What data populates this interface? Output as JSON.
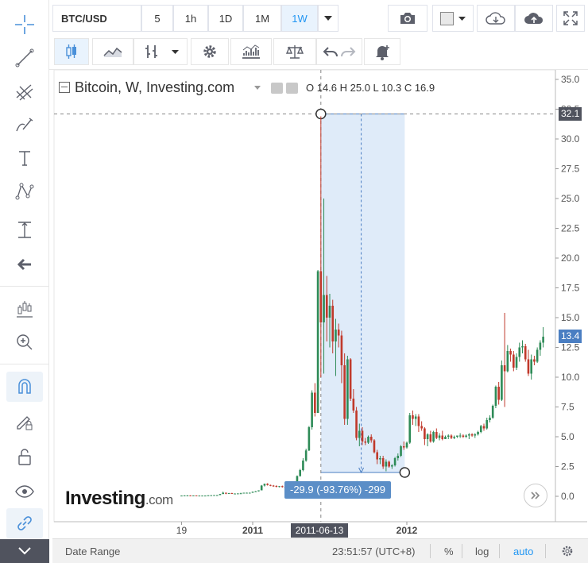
{
  "toolbar": {
    "symbol": "BTC/USD",
    "intervals": [
      "5",
      "1h",
      "1D",
      "1M",
      "1W"
    ],
    "active_interval": "1W"
  },
  "legend": {
    "title": "Bitcoin, W, Investing.com",
    "ohlc": "O 14.6  H 25.0  L 10.3  C 16.9"
  },
  "price_tags": {
    "crosshair": "32.1",
    "last": "13.4"
  },
  "measure": {
    "label": "-29.9 (-93.76%) -299"
  },
  "crosshair_date": "2011-06-13",
  "logo": {
    "main": "Investing",
    "suffix": ".com"
  },
  "bottom": {
    "date_range": "Date Range",
    "time": "23:51:57 (UTC+8)",
    "percent": "%",
    "log": "log",
    "auto": "auto"
  },
  "colors": {
    "up": "#2e8b57",
    "down": "#c0392b",
    "measure_fill": "#dbe9f8",
    "accent": "#2196f3",
    "last_price": "#4a7ec2"
  },
  "chart_data": {
    "type": "candlestick",
    "y_ticks": [
      "35.0",
      "32.5",
      "30.0",
      "27.5",
      "25.0",
      "22.5",
      "20.0",
      "17.5",
      "15.0",
      "12.5",
      "10.0",
      "7.5",
      "5.0",
      "2.5",
      "0.0"
    ],
    "x_ticks": [
      "19",
      "2011",
      "2012"
    ],
    "ylim": [
      -1,
      35.5
    ],
    "x_start": "2010-07-19",
    "interval": "1W",
    "ohlc": [
      [
        0.05,
        0.07,
        0.05,
        0.06
      ],
      [
        0.06,
        0.08,
        0.05,
        0.07
      ],
      [
        0.07,
        0.09,
        0.06,
        0.07
      ],
      [
        0.07,
        0.08,
        0.06,
        0.06
      ],
      [
        0.06,
        0.07,
        0.06,
        0.07
      ],
      [
        0.07,
        0.07,
        0.06,
        0.06
      ],
      [
        0.06,
        0.07,
        0.06,
        0.06
      ],
      [
        0.06,
        0.07,
        0.06,
        0.06
      ],
      [
        0.06,
        0.07,
        0.06,
        0.06
      ],
      [
        0.06,
        0.09,
        0.06,
        0.08
      ],
      [
        0.08,
        0.1,
        0.08,
        0.09
      ],
      [
        0.09,
        0.11,
        0.09,
        0.1
      ],
      [
        0.1,
        0.11,
        0.09,
        0.1
      ],
      [
        0.1,
        0.2,
        0.1,
        0.19
      ],
      [
        0.19,
        0.39,
        0.19,
        0.3
      ],
      [
        0.3,
        0.31,
        0.18,
        0.22
      ],
      [
        0.22,
        0.28,
        0.2,
        0.27
      ],
      [
        0.27,
        0.29,
        0.21,
        0.23
      ],
      [
        0.23,
        0.25,
        0.22,
        0.23
      ],
      [
        0.23,
        0.25,
        0.2,
        0.24
      ],
      [
        0.24,
        0.3,
        0.23,
        0.25
      ],
      [
        0.25,
        0.3,
        0.24,
        0.3
      ],
      [
        0.3,
        0.31,
        0.28,
        0.3
      ],
      [
        0.3,
        0.31,
        0.29,
        0.3
      ],
      [
        0.3,
        0.39,
        0.29,
        0.38
      ],
      [
        0.38,
        0.45,
        0.37,
        0.42
      ],
      [
        0.42,
        0.5,
        0.41,
        0.5
      ],
      [
        0.5,
        0.95,
        0.5,
        0.9
      ],
      [
        0.9,
        1.06,
        0.82,
        1.05
      ],
      [
        1.05,
        1.1,
        0.9,
        0.95
      ],
      [
        0.95,
        0.98,
        0.85,
        0.9
      ],
      [
        0.9,
        0.95,
        0.8,
        0.87
      ],
      [
        0.87,
        0.92,
        0.75,
        0.8
      ],
      [
        0.8,
        0.86,
        0.75,
        0.85
      ],
      [
        0.85,
        0.9,
        0.73,
        0.8
      ],
      [
        0.8,
        0.83,
        0.7,
        0.78
      ],
      [
        0.78,
        0.82,
        0.66,
        0.68
      ],
      [
        0.68,
        0.85,
        0.66,
        0.8
      ],
      [
        0.8,
        1.2,
        0.78,
        1.15
      ],
      [
        1.15,
        1.75,
        1.1,
        1.7
      ],
      [
        1.7,
        2.3,
        1.65,
        2.2
      ],
      [
        2.2,
        3.2,
        2.1,
        3.0
      ],
      [
        3.0,
        4.0,
        2.9,
        3.85
      ],
      [
        3.85,
        5.9,
        3.8,
        5.8
      ],
      [
        5.8,
        8.9,
        5.6,
        8.7
      ],
      [
        8.7,
        9.5,
        6.7,
        7.0
      ],
      [
        7.0,
        19.0,
        7.0,
        18.9
      ],
      [
        18.9,
        31.9,
        10.0,
        14.6
      ],
      [
        14.6,
        25.0,
        10.3,
        16.9
      ],
      [
        16.9,
        18.5,
        13.0,
        15.0
      ],
      [
        15.0,
        17.0,
        12.5,
        16.0
      ],
      [
        16.0,
        16.5,
        12.0,
        13.0
      ],
      [
        13.0,
        14.9,
        10.1,
        14.0
      ],
      [
        14.0,
        14.5,
        12.5,
        13.5
      ],
      [
        13.5,
        13.9,
        9.5,
        11.0
      ],
      [
        11.0,
        12.0,
        6.0,
        6.5
      ],
      [
        6.5,
        11.8,
        6.0,
        11.5
      ],
      [
        11.5,
        11.6,
        8.0,
        8.2
      ],
      [
        8.2,
        9.0,
        7.0,
        7.2
      ],
      [
        7.2,
        7.5,
        4.7,
        4.9
      ],
      [
        4.9,
        6.1,
        4.2,
        5.5
      ],
      [
        5.5,
        5.8,
        4.3,
        4.6
      ],
      [
        4.6,
        4.9,
        4.3,
        4.5
      ],
      [
        4.5,
        5.1,
        4.4,
        5.0
      ],
      [
        5.0,
        5.2,
        4.5,
        4.7
      ],
      [
        4.7,
        4.8,
        3.6,
        3.7
      ],
      [
        3.7,
        3.9,
        2.7,
        3.1
      ],
      [
        3.1,
        3.4,
        2.7,
        3.2
      ],
      [
        3.2,
        3.4,
        2.3,
        2.5
      ],
      [
        2.5,
        3.1,
        2.1,
        2.9
      ],
      [
        2.9,
        3.0,
        2.4,
        2.5
      ],
      [
        2.5,
        2.7,
        2.3,
        2.6
      ],
      [
        2.6,
        3.3,
        2.5,
        3.2
      ],
      [
        3.2,
        3.6,
        3.0,
        3.4
      ],
      [
        3.4,
        4.3,
        3.3,
        4.2
      ],
      [
        4.2,
        4.6,
        3.9,
        4.1
      ],
      [
        4.1,
        4.6,
        4.0,
        4.5
      ],
      [
        4.5,
        7.0,
        4.4,
        6.8
      ],
      [
        6.8,
        7.2,
        6.0,
        6.5
      ],
      [
        6.5,
        6.9,
        5.9,
        6.7
      ],
      [
        6.7,
        6.9,
        5.4,
        5.9
      ],
      [
        5.9,
        6.3,
        5.5,
        5.7
      ],
      [
        5.7,
        5.8,
        4.3,
        4.8
      ],
      [
        4.8,
        5.3,
        4.2,
        5.2
      ],
      [
        5.2,
        5.5,
        4.5,
        4.6
      ],
      [
        4.6,
        5.5,
        4.5,
        5.4
      ],
      [
        5.4,
        5.7,
        4.8,
        4.9
      ],
      [
        4.9,
        5.3,
        4.7,
        5.1
      ],
      [
        5.1,
        5.5,
        4.7,
        4.8
      ],
      [
        4.8,
        5.1,
        4.8,
        5.0
      ],
      [
        5.0,
        5.2,
        4.8,
        5.1
      ],
      [
        5.1,
        5.2,
        4.8,
        4.9
      ],
      [
        4.9,
        5.1,
        4.8,
        5.0
      ],
      [
        5.0,
        5.1,
        4.9,
        5.1
      ],
      [
        5.1,
        5.3,
        4.9,
        5.1
      ],
      [
        5.1,
        5.2,
        4.9,
        5.0
      ],
      [
        5.0,
        5.2,
        4.9,
        5.1
      ],
      [
        5.1,
        5.3,
        4.8,
        5.2
      ],
      [
        5.2,
        5.3,
        5.0,
        5.1
      ],
      [
        5.1,
        5.3,
        4.9,
        5.2
      ],
      [
        5.2,
        5.5,
        5.1,
        5.4
      ],
      [
        5.4,
        6.0,
        5.3,
        5.9
      ],
      [
        5.9,
        6.1,
        5.5,
        5.7
      ],
      [
        5.7,
        6.6,
        5.6,
        6.4
      ],
      [
        6.4,
        6.8,
        6.2,
        6.6
      ],
      [
        6.6,
        7.7,
        6.5,
        7.6
      ],
      [
        7.6,
        9.3,
        7.4,
        9.2
      ],
      [
        9.2,
        9.6,
        7.7,
        8.1
      ],
      [
        8.1,
        11.4,
        8.0,
        11.0
      ],
      [
        11.0,
        15.4,
        7.5,
        10.5
      ],
      [
        10.5,
        12.7,
        10.4,
        12.2
      ],
      [
        12.2,
        12.4,
        11.3,
        11.9
      ],
      [
        11.9,
        12.2,
        10.5,
        10.8
      ],
      [
        10.8,
        12.0,
        10.6,
        11.7
      ],
      [
        11.7,
        12.9,
        11.3,
        12.5
      ],
      [
        12.5,
        13.1,
        12.0,
        12.6
      ],
      [
        12.6,
        12.8,
        11.3,
        11.5
      ],
      [
        11.5,
        12.3,
        10.1,
        10.3
      ],
      [
        10.3,
        11.9,
        9.8,
        11.5
      ],
      [
        11.5,
        11.8,
        11.0,
        11.3
      ],
      [
        11.3,
        12.5,
        11.2,
        12.3
      ],
      [
        12.3,
        13.1,
        11.8,
        12.9
      ],
      [
        12.9,
        14.2,
        12.5,
        13.4
      ]
    ],
    "measure": {
      "from_price": 31.9,
      "to_price": 2.0,
      "change": -29.9,
      "percent": -93.76,
      "bars": -299
    },
    "crosshair_price": 32.1,
    "last_price": 13.4
  }
}
